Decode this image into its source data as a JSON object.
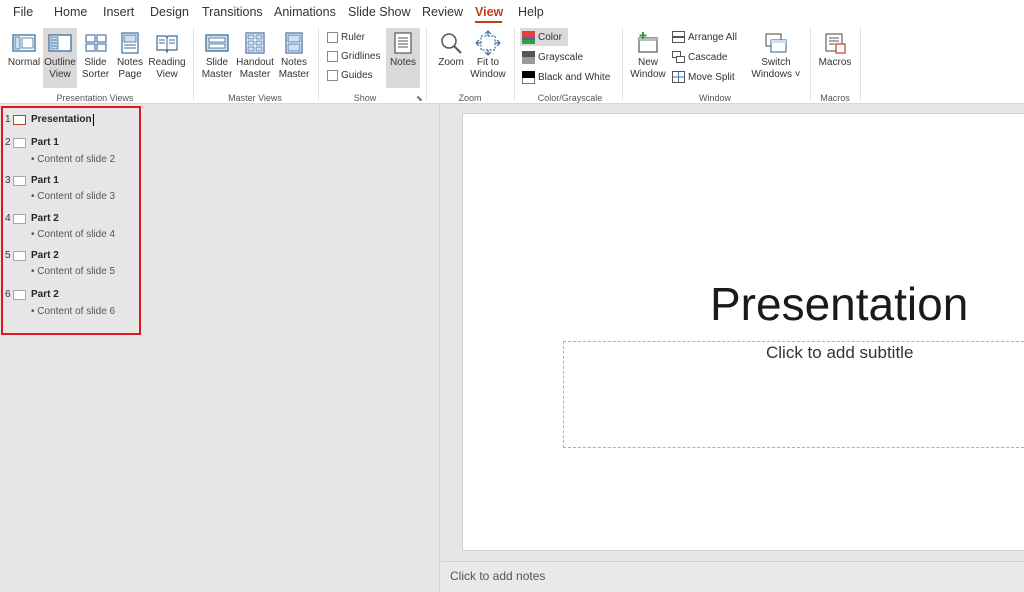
{
  "tabs": [
    "File",
    "Home",
    "Insert",
    "Design",
    "Transitions",
    "Animations",
    "Slide Show",
    "Review",
    "View",
    "Help"
  ],
  "active_tab": "View",
  "ribbon": {
    "presentation_views": {
      "label": "Presentation Views",
      "buttons": [
        {
          "label1": "Normal",
          "label2": ""
        },
        {
          "label1": "Outline",
          "label2": "View"
        },
        {
          "label1": "Slide",
          "label2": "Sorter"
        },
        {
          "label1": "Notes",
          "label2": "Page"
        },
        {
          "label1": "Reading",
          "label2": "View"
        }
      ]
    },
    "master_views": {
      "label": "Master Views",
      "buttons": [
        {
          "label1": "Slide",
          "label2": "Master"
        },
        {
          "label1": "Handout",
          "label2": "Master"
        },
        {
          "label1": "Notes",
          "label2": "Master"
        }
      ]
    },
    "show": {
      "label": "Show",
      "ruler": "Ruler",
      "gridlines": "Gridlines",
      "guides": "Guides",
      "notes": "Notes"
    },
    "zoom": {
      "label": "Zoom",
      "zoom_btn": "Zoom",
      "fit1": "Fit to",
      "fit2": "Window"
    },
    "color": {
      "label": "Color/Grayscale",
      "color": "Color",
      "grayscale": "Grayscale",
      "bw": "Black and White"
    },
    "window": {
      "label": "Window",
      "new1": "New",
      "new2": "Window",
      "arrange_all": "Arrange All",
      "cascade": "Cascade",
      "move_split": "Move Split",
      "switch1": "Switch",
      "switch2": "Windows ˅"
    },
    "macros": {
      "label": "Macros",
      "btn": "Macros"
    }
  },
  "outline": [
    {
      "num": "1",
      "title": "Presentation",
      "content": ""
    },
    {
      "num": "2",
      "title": "Part 1",
      "content": "• Content of slide 2"
    },
    {
      "num": "3",
      "title": "Part 1",
      "content": "• Content of slide 3"
    },
    {
      "num": "4",
      "title": "Part 2",
      "content": "• Content of slide 4"
    },
    {
      "num": "5",
      "title": "Part 2",
      "content": "• Content of slide 5"
    },
    {
      "num": "6",
      "title": "Part 2",
      "content": "• Content of slide 6"
    }
  ],
  "slide": {
    "title": "Presentation",
    "subtitle_placeholder": "Click to add subtitle"
  },
  "notes_placeholder": "Click to add notes",
  "colors": {
    "accent": "#c43e1c",
    "highlight_box": "#e0171d"
  }
}
